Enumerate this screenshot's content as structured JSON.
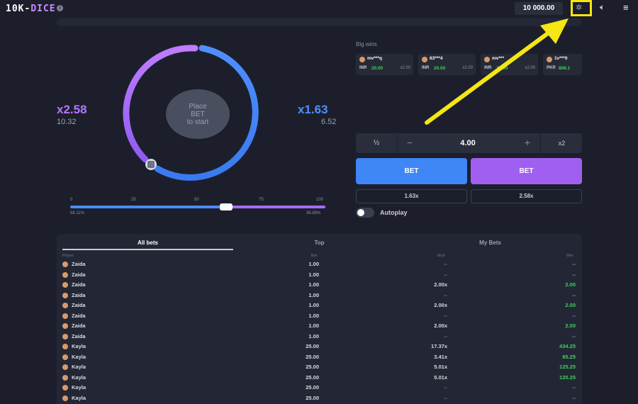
{
  "header": {
    "logo_prefix": "10K-",
    "logo_suffix": "DICE",
    "info_icon": "info-icon",
    "balance": "10 000.00",
    "fairness_icon": "sparkle-icon",
    "sound_icon": "speaker-icon",
    "menu_icon": "hamburger-icon"
  },
  "game": {
    "left_multiplier": "x2.58",
    "left_value": "10.32",
    "right_multiplier": "x1.63",
    "right_value": "6.52",
    "center_prompt": "Place\nBET\nto start",
    "slider": {
      "ticks": [
        "0",
        "25",
        "50",
        "75",
        "100"
      ],
      "left_percent": "58.11%",
      "right_percent": "36.89%"
    }
  },
  "big_wins": {
    "title": "Big wins",
    "items": [
      {
        "name": "mv***q",
        "currency": "INR",
        "amount": "20.00",
        "mult": "x2.00"
      },
      {
        "name": "63***4",
        "currency": "INR",
        "amount": "20.00",
        "mult": "x2.00"
      },
      {
        "name": "mv***",
        "currency": "INR",
        "amount": "20.00",
        "mult": "x2.00"
      },
      {
        "name": "1v***0",
        "currency": "PKR",
        "amount": "808.1",
        "mult": ""
      }
    ]
  },
  "controls": {
    "half_label": "½",
    "minus_label": "−",
    "amount": "4.00",
    "plus_label": "+",
    "double_label": "x2",
    "bet_left_label": "BET",
    "bet_right_label": "BET",
    "mult_left": "1.63x",
    "mult_right": "2.58x",
    "autoplay_label": "Autoplay"
  },
  "bets_table": {
    "tabs": [
      "All bets",
      "Top",
      "My Bets"
    ],
    "columns": [
      "Player",
      "Bet",
      "Mult",
      "Win"
    ],
    "rows": [
      {
        "player": "Zaida",
        "bet": "1.00",
        "mult": "--",
        "win": "--"
      },
      {
        "player": "Zaida",
        "bet": "1.00",
        "mult": "--",
        "win": "--"
      },
      {
        "player": "Zaida",
        "bet": "1.00",
        "mult": "2.00x",
        "win": "2.00"
      },
      {
        "player": "Zaida",
        "bet": "1.00",
        "mult": "--",
        "win": "--"
      },
      {
        "player": "Zaida",
        "bet": "1.00",
        "mult": "2.00x",
        "win": "2.00"
      },
      {
        "player": "Zaida",
        "bet": "1.00",
        "mult": "--",
        "win": "--"
      },
      {
        "player": "Zaida",
        "bet": "1.00",
        "mult": "2.00x",
        "win": "2.00"
      },
      {
        "player": "Zaida",
        "bet": "1.00",
        "mult": "--",
        "win": "--"
      },
      {
        "player": "Kayla",
        "bet": "25.00",
        "mult": "17.37x",
        "win": "434.25"
      },
      {
        "player": "Kayla",
        "bet": "25.00",
        "mult": "3.41x",
        "win": "85.25"
      },
      {
        "player": "Kayla",
        "bet": "25.00",
        "mult": "5.01x",
        "win": "125.25"
      },
      {
        "player": "Kayla",
        "bet": "25.00",
        "mult": "5.01x",
        "win": "125.25"
      },
      {
        "player": "Kayla",
        "bet": "25.00",
        "mult": "--",
        "win": "--"
      },
      {
        "player": "Kayla",
        "bet": "25.00",
        "mult": "--",
        "win": "--"
      }
    ]
  },
  "colors": {
    "accent_blue": "#3f86f7",
    "accent_purple": "#a15ff2",
    "win_green": "#3ed15b",
    "highlight_yellow": "#f5e614"
  }
}
